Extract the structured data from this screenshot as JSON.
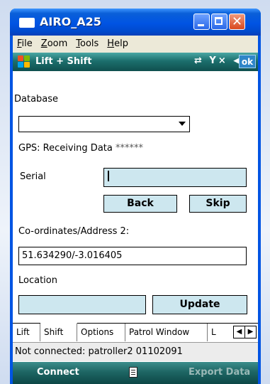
{
  "window": {
    "title": "AIRO_A25",
    "close_glyph": "✕"
  },
  "menubar": {
    "items": [
      "File",
      "Zoom",
      "Tools",
      "Help"
    ]
  },
  "device_status": {
    "title": "Lift + Shift",
    "icons": "⇄ Y× ◀(",
    "ok_label": "ok"
  },
  "form": {
    "database_label": "Database",
    "database_value": "",
    "gps_status": "GPS: Receiving Data",
    "gps_stars": "******",
    "serial_label": "Serial",
    "serial_value": "",
    "back_label": "Back",
    "skip_label": "Skip",
    "coords_label": "Co-ordinates/Address 2:",
    "coords_value": "51.634290/-3.016405",
    "location_label": "Location",
    "location_value": "",
    "update_label": "Update"
  },
  "tabs": {
    "items": [
      "Lift",
      "Shift",
      "Options",
      "Patrol Window",
      "L"
    ],
    "active": "Shift",
    "prev_glyph": "◀",
    "next_glyph": "▶"
  },
  "connection_status": "Not connected: patroller2 01102091",
  "softkeys": {
    "left": "Connect",
    "right": "Export Data"
  },
  "colors": {
    "field_bg": "#cde7ef",
    "titlebar_blue": "#0054e3",
    "status_teal": "#1c6f6d"
  }
}
